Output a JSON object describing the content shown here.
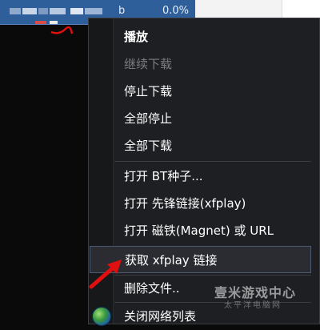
{
  "task_row": {
    "status": "0.0%",
    "letter": "b"
  },
  "context_menu": {
    "items": [
      {
        "label": "播放",
        "state": "bold"
      },
      {
        "label": "继续下载",
        "state": "disabled"
      },
      {
        "label": "停止下载",
        "state": "normal"
      },
      {
        "label": "全部停止",
        "state": "normal"
      },
      {
        "label": "全部下载",
        "state": "normal"
      },
      {
        "label": "打开 BT种子...",
        "state": "normal"
      },
      {
        "label": "打开 先锋链接(xfplay)",
        "state": "normal"
      },
      {
        "label": "打开 磁铁(Magnet) 或 URL",
        "state": "normal"
      },
      {
        "label": "获取 xfplay 链接",
        "state": "highlighted"
      },
      {
        "label": "删除文件..",
        "state": "normal"
      },
      {
        "label": "关闭网络列表",
        "state": "normal"
      }
    ]
  },
  "watermark": {
    "text": "壹米游戏中心",
    "sub": "太平洋电脑网"
  },
  "colors": {
    "menu_bg": "#1e1f22",
    "row_selected": "#2f5f9a",
    "arrow": "#e01010"
  },
  "icons": {
    "globe": "globe-icon",
    "arrow": "red-arrow-annotation"
  }
}
